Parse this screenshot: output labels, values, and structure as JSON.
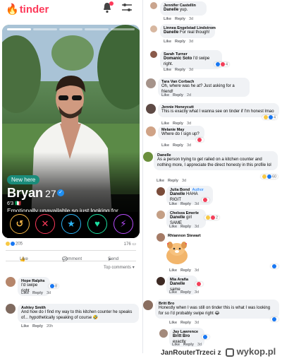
{
  "tinder": {
    "logo": "tinder",
    "card": {
      "badge": "New here",
      "name": "Bryan",
      "age": "27",
      "meta": "6'3 🇮🇹",
      "bio": "Emotionally unavailable so just looking for someone to rail on my kitchen counter Speak 3 languages"
    },
    "actions": [
      "↺",
      "✕",
      "★",
      "♥",
      "⚡"
    ]
  },
  "post": {
    "reactions_count": "205",
    "comments_count": "176",
    "like_label": "Like",
    "comment_label": "Comment",
    "send_label": "Send",
    "sort_label": "Top comments"
  },
  "comments_left": [
    {
      "name": "Hope Ralphs",
      "text": "I'd swipe right",
      "meta": [
        "Like",
        "Reply",
        "3d"
      ],
      "count": "8"
    },
    {
      "name": "Ashley Smith",
      "text": "And how do I find my way to this kitchen counter he speaks of... hypothetically speaking of course 🤣",
      "meta": [
        "Like",
        "Reply",
        "20h"
      ]
    }
  ],
  "comments_right": [
    {
      "name": "Jennifer Castellin",
      "mention": "Danelle",
      "text": "yup.",
      "meta": [
        "Like",
        "Reply",
        "3d"
      ]
    },
    {
      "name": "Linnea Engelstad Lindstrom",
      "mention": "Danelle",
      "text": "For real though!",
      "meta": [
        "Like",
        "Reply",
        "3d"
      ]
    },
    {
      "name": "Sarah Turner",
      "mention": "Domanic Soto",
      "text": "I'd swipe right.",
      "meta": [
        "Like",
        "Reply",
        "3d"
      ],
      "count": "4"
    },
    {
      "name": "Tara Van Corbach",
      "mention": "",
      "text": "Oh, where was he at? Just asking for a friend!",
      "meta": [
        "Like",
        "Reply",
        "2d"
      ]
    },
    {
      "name": "Jennie Honeycutt",
      "mention": "",
      "text": "This is exactly what I wanna see on tinder if I'm honest lmao",
      "meta": [
        "Like",
        "Reply",
        "3d"
      ],
      "count": "4"
    },
    {
      "name": "Melanie May",
      "mention": "",
      "text": "Where do I sign up?",
      "meta": [
        "Like",
        "Reply",
        "3d"
      ]
    },
    {
      "name": "Danelle",
      "mention": "",
      "text": "As a person trying to get railed on a kitchen counter and nothing more, I appreciate the direct honesty in this profile lol",
      "meta": [
        "Like",
        "Reply",
        "3d"
      ],
      "count": "60"
    },
    {
      "name": "Julia Bond",
      "author_badge": "Author",
      "mention": "Danelle",
      "text": "HAHA RIGIT",
      "meta": [
        "Like",
        "Reply",
        "3d"
      ]
    },
    {
      "name": "Chelsea Emerle",
      "mention": "Danelle",
      "text": "girl SAME",
      "meta": [
        "Like",
        "Reply",
        "3d"
      ],
      "count": "2"
    },
    {
      "name": "Rhiannon Stewart",
      "mention": "",
      "text": "",
      "meta": [
        "Like",
        "Reply",
        "3d"
      ]
    },
    {
      "name": "Mia Araña",
      "mention": "Danelle",
      "text": "same",
      "meta": [
        "Like",
        "Reply",
        "3d"
      ]
    },
    {
      "name": "Britt Bro",
      "mention": "",
      "text": "Honestly when I was still on tinder this is what I was looking for so I'd probably swipe right 😂",
      "meta": [
        "Like",
        "Reply",
        "3d"
      ]
    },
    {
      "name": "Jay Lawrence",
      "mention": "Britt Bro",
      "text": "exactly",
      "meta": [
        "Like",
        "Reply",
        "3d"
      ]
    }
  ],
  "watermark": {
    "user": "JanRouterTrzeci",
    "sep": "z",
    "site": "wykop.pl"
  },
  "colors": {
    "tinder_red": "#fd3a5a",
    "fb_bubble": "#f0f2f5",
    "fb_meta": "#65676b",
    "like_blue": "#1877f2"
  }
}
